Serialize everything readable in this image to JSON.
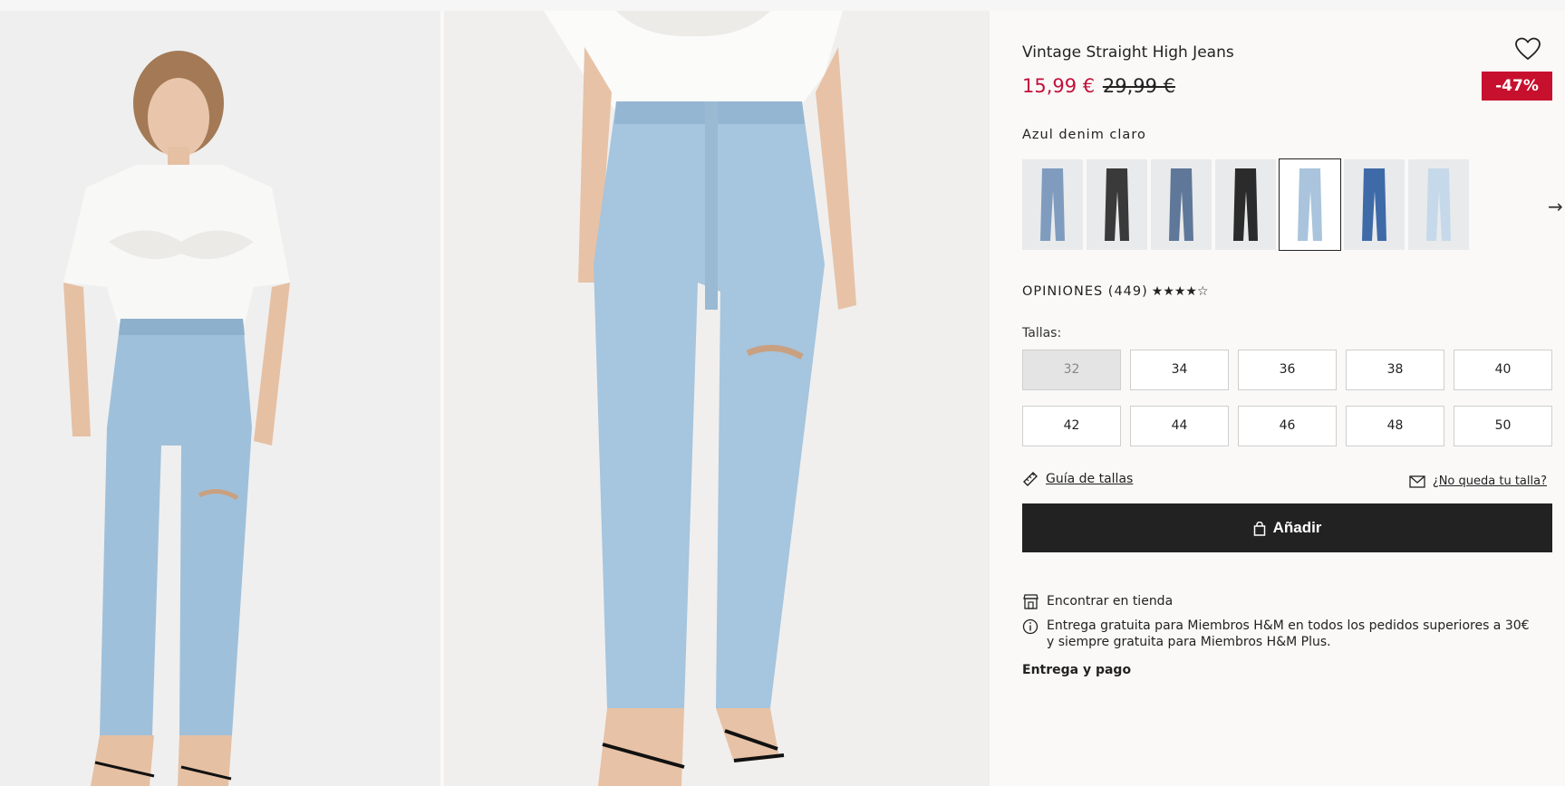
{
  "product": {
    "title": "Vintage Straight High Jeans",
    "price_now": "15,99 €",
    "price_old": "29,99 €",
    "discount": "-47%",
    "color_name": "Azul denim claro"
  },
  "swatches": [
    {
      "name": "blue-mid",
      "color": "#7f9cbf"
    },
    {
      "name": "black-washed",
      "color": "#3a3a3a"
    },
    {
      "name": "blue-dark-gray",
      "color": "#5f7899"
    },
    {
      "name": "black",
      "color": "#2b2b2b"
    },
    {
      "name": "light-blue",
      "color": "#a9c4dc",
      "selected": true
    },
    {
      "name": "denim-blue",
      "color": "#3f6aa8"
    },
    {
      "name": "pale-blue",
      "color": "#c6d9ea"
    }
  ],
  "reviews": {
    "label": "OPINIONES (449)",
    "stars": "★★★★☆"
  },
  "sizes": {
    "label": "Tallas:",
    "items": [
      {
        "label": "32",
        "available": false
      },
      {
        "label": "34",
        "available": true
      },
      {
        "label": "36",
        "available": true
      },
      {
        "label": "38",
        "available": true
      },
      {
        "label": "40",
        "available": true
      },
      {
        "label": "42",
        "available": true
      },
      {
        "label": "44",
        "available": true
      },
      {
        "label": "46",
        "available": true
      },
      {
        "label": "48",
        "available": true
      },
      {
        "label": "50",
        "available": true
      }
    ]
  },
  "links": {
    "size_guide": "Guía de tallas",
    "no_fit": "¿No queda tu talla?"
  },
  "add_button": "Añadir",
  "store": "Encontrar en tienda",
  "info": "Entrega gratuita para Miembros H&M en todos los pedidos superiores a 30€ y siempre gratuita para Miembros H&M Plus.",
  "delivery": "Entrega y pago",
  "colors": {
    "accent_price": "#c2113a",
    "discount_bg": "#c7102e",
    "button_bg": "#222222"
  },
  "icons": {
    "wishlist": "heart-icon",
    "next": "arrow-right-icon",
    "ruler": "ruler-icon",
    "mail": "envelope-icon",
    "bag": "bag-icon",
    "store": "store-icon",
    "info": "info-icon"
  }
}
